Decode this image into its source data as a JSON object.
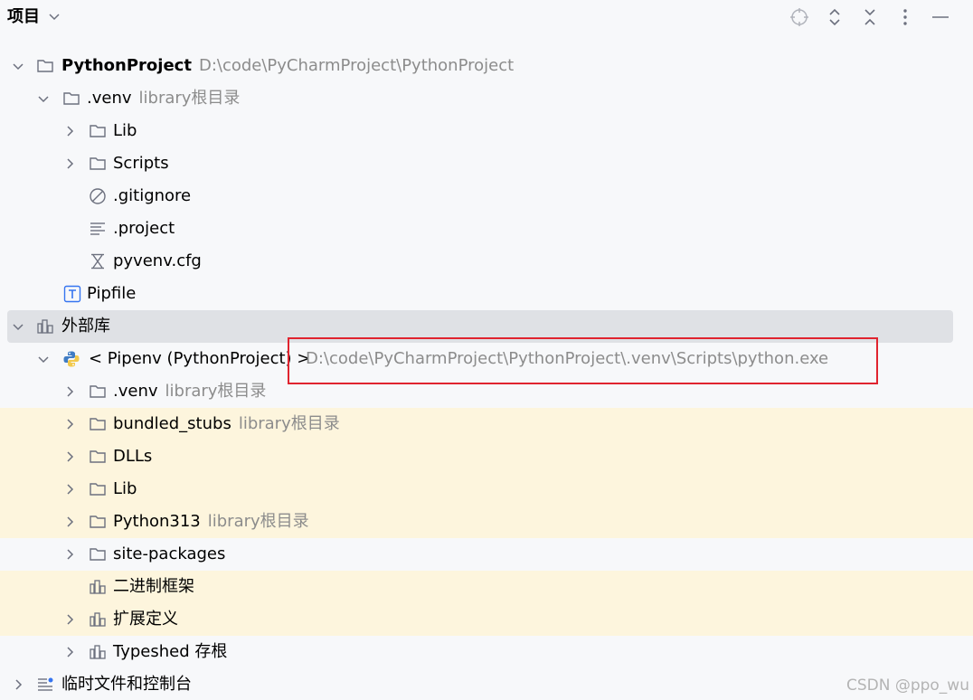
{
  "header": {
    "title": "项目",
    "tools": [
      "locate-icon",
      "expand-all-icon",
      "collapse-all-icon",
      "more-icon",
      "minimize-icon"
    ]
  },
  "tree": {
    "project_root": {
      "label": "PythonProject",
      "hint": "D:\\code\\PyCharmProject\\PythonProject"
    },
    "venv": {
      "label": ".venv",
      "hint": "library根目录"
    },
    "lib": {
      "label": "Lib"
    },
    "scripts": {
      "label": "Scripts"
    },
    "gitignore": {
      "label": ".gitignore"
    },
    "project_file": {
      "label": ".project"
    },
    "pyvenv": {
      "label": "pyvenv.cfg"
    },
    "pipfile": {
      "label": "Pipfile"
    },
    "external_libs": {
      "label": "外部库"
    },
    "sdk": {
      "label": "< Pipenv (PythonProject) >",
      "hint": "D:\\code\\PyCharmProject\\PythonProject\\.venv\\Scripts\\python.exe"
    },
    "sdk_venv": {
      "label": ".venv",
      "hint": "library根目录"
    },
    "bundled_stubs": {
      "label": "bundled_stubs",
      "hint": "library根目录"
    },
    "dlls": {
      "label": "DLLs"
    },
    "sdk_lib": {
      "label": "Lib"
    },
    "python313": {
      "label": "Python313",
      "hint": "library根目录"
    },
    "site_packages": {
      "label": "site-packages"
    },
    "binary_skeletons": {
      "label": "二进制框架"
    },
    "extended_defs": {
      "label": "扩展定义"
    },
    "typeshed": {
      "label": "Typeshed 存根"
    },
    "scratches": {
      "label": "临时文件和控制台"
    }
  },
  "watermark": "CSDN @ppo_wu",
  "colors": {
    "highlight_row": "#fdf5dd",
    "selected_row": "#dfe1e5",
    "annotation_box": "#e0242f",
    "hint_text": "#8c8c8c"
  }
}
